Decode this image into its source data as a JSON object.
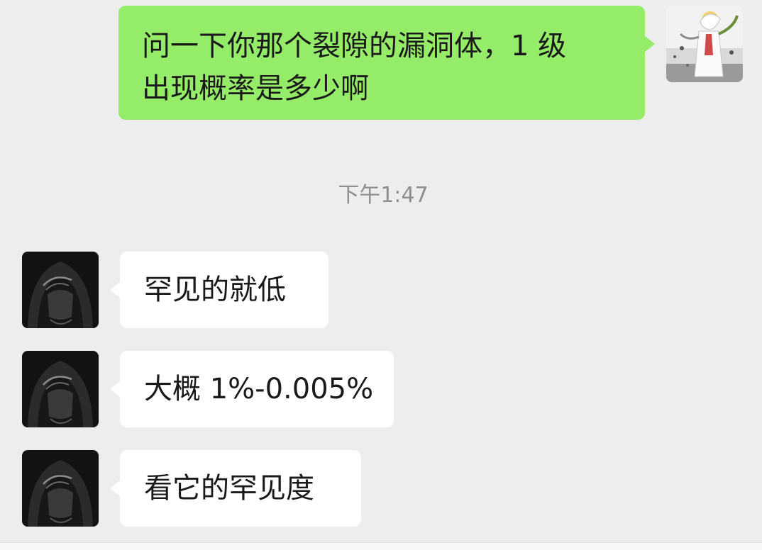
{
  "messages": [
    {
      "side": "outgoing",
      "avatar": "anime-character-avatar",
      "lines": [
        "问一下你那个裂隙的漏洞体，1 级",
        "出现概率是多少啊"
      ]
    },
    {
      "side": "incoming",
      "avatar": "hooded-figure-avatar",
      "lines": [
        "罕见的就低"
      ]
    },
    {
      "side": "incoming",
      "avatar": "hooded-figure-avatar",
      "lines": [
        "大概 1%-0.005%"
      ]
    },
    {
      "side": "incoming",
      "avatar": "hooded-figure-avatar",
      "lines": [
        "看它的罕见度"
      ]
    }
  ],
  "timestamp": "下午1:47",
  "colors": {
    "background": "#ededed",
    "outgoing_bubble": "#95ec69",
    "incoming_bubble": "#ffffff",
    "timestamp_text": "#8f8f8f"
  }
}
